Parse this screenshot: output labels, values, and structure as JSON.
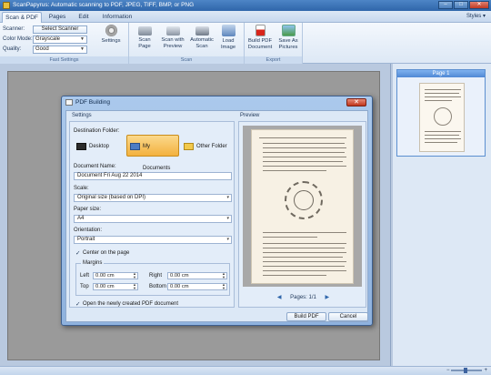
{
  "window": {
    "title": "ScanPapyrus: Automatic scanning to PDF, JPEG, TIFF, BMP, or PNG",
    "minimize": "–",
    "maximize": "□",
    "close": "✕"
  },
  "menu": {
    "tabs": [
      "Scan & PDF",
      "Pages",
      "Edit",
      "Information"
    ],
    "styles": "Styles"
  },
  "ribbon": {
    "scanner_label": "Scanner:",
    "select_scanner": "Select Scanner",
    "color_mode_label": "Color Mode:",
    "color_mode_value": "Grayscale",
    "quality_label": "Quality:",
    "quality_value": "Good",
    "settings": "Settings",
    "scan_page": [
      "Scan",
      "Page"
    ],
    "scan_with_preview": [
      "Scan with",
      "Preview"
    ],
    "automatic_scan": [
      "Automatic",
      "Scan"
    ],
    "load_image": [
      "Load",
      "Image"
    ],
    "build_pdf": [
      "Build PDF",
      "Document"
    ],
    "save_as_pictures": [
      "Save As",
      "Pictures"
    ],
    "group_fast_settings": "Fast Settings",
    "group_scan": "Scan",
    "group_export": "Export"
  },
  "thumbnails": {
    "page_label": "Page 1"
  },
  "dialog": {
    "title": "PDF Building",
    "settings_title": "Settings",
    "destination_label": "Destination Folder:",
    "dest_desktop": "Desktop",
    "dest_my_documents": "My Documents",
    "dest_other": "Other Folder",
    "doc_name_label": "Document Name:",
    "doc_name_value": "Document Fri Aug 22 2014",
    "scale_label": "Scale:",
    "scale_value": "Original size (based on DPI)",
    "paper_label": "Paper size:",
    "paper_value": "A4",
    "orientation_label": "Orientation:",
    "orientation_value": "Portrait",
    "center_label": "Center on the page",
    "margins_title": "Margins",
    "left_label": "Left",
    "right_label": "Right",
    "top_label": "Top",
    "bottom_label": "Bottom",
    "left_value": "0.00 cm",
    "right_value": "0.00 cm",
    "top_value": "0.00 cm",
    "bottom_value": "0.00 cm",
    "open_label": "Open the newly created PDF document",
    "preview_title": "Preview",
    "pager": "Pages: 1/1",
    "prev": "◀",
    "next": "▶",
    "build_button": "Build PDF",
    "cancel_button": "Cancel"
  }
}
